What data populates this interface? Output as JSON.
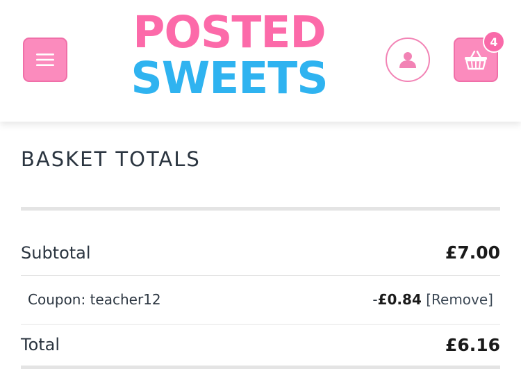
{
  "header": {
    "logo_line1": "POSTED",
    "logo_line2": "SWEETS",
    "cart_count": "4",
    "menu_icon": "hamburger-menu-icon",
    "account_icon": "user-icon",
    "cart_icon": "basket-icon"
  },
  "colors": {
    "pink": "#fb8bbd",
    "logo_pink": "#fc6aa9",
    "logo_blue": "#2fb3f0"
  },
  "basket_totals": {
    "title": "BASKET TOTALS",
    "subtotal_label": "Subtotal",
    "subtotal_value": "£7.00",
    "coupon_label": "Coupon: teacher12",
    "coupon_sign": "-",
    "coupon_value": "£0.84",
    "coupon_remove": "[Remove]",
    "total_label": "Total",
    "total_value": "£6.16"
  }
}
